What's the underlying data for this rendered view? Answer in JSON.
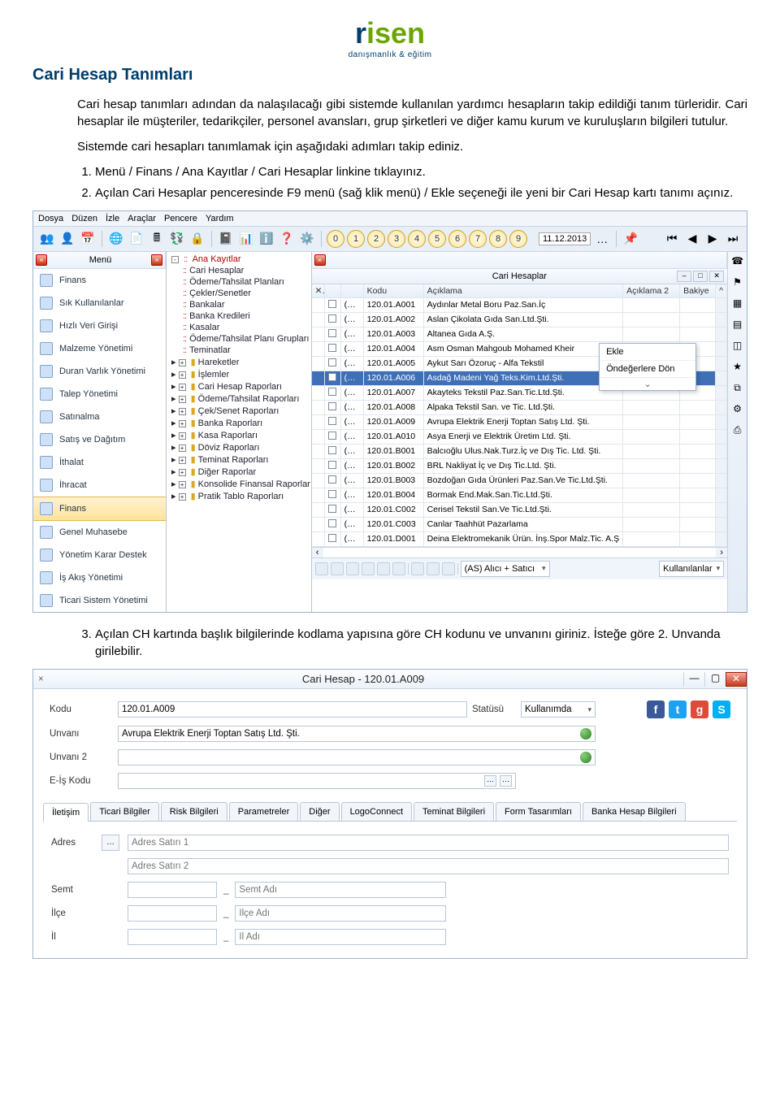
{
  "logo": {
    "brand_r": "r",
    "brand_isen": "isen",
    "sub": "danışmanlık & eğitim"
  },
  "doc_title": "Cari Hesap Tanımları",
  "para1": "Cari hesap tanımları adından da nalaşılacağı gibi sistemde kullanılan yardımcı hesapların takip edildiği tanım türleridir. Cari hesaplar ile müşteriler, tedarikçiler, personel avansları, grup şirketleri ve diğer kamu kurum ve kuruluşların bilgileri tutulur.",
  "para2": "Sistemde cari hesapları tanımlamak için aşağıdaki adımları takip ediniz.",
  "steps1": [
    "Menü / Finans / Ana Kayıtlar / Cari Hesaplar linkine tıklayınız.",
    "Açılan Cari Hesaplar penceresinde F9 menü (sağ klik menü) / Ekle seçeneği ile yeni bir Cari Hesap kartı tanımı açınız."
  ],
  "step3": "Açılan CH kartında başlık bilgilerinde kodlama yapısına göre CH kodunu ve unvanını giriniz. İsteğe göre 2. Unvanda girilebilir.",
  "app": {
    "menu": [
      "Dosya",
      "Düzen",
      "İzle",
      "Araçlar",
      "Pencere",
      "Yardım"
    ],
    "date": "11.12.2013",
    "nums": [
      "0",
      "1",
      "2",
      "3",
      "4",
      "5",
      "6",
      "7",
      "8",
      "9"
    ],
    "sidebar_title": "Menü",
    "side_items": [
      "Finans",
      "Sık Kullanılanlar",
      "Hızlı Veri Girişi",
      "Malzeme Yönetimi",
      "Duran Varlık Yönetimi",
      "Talep Yönetimi",
      "Satınalma",
      "Satış ve Dağıtım",
      "İthalat",
      "İhracat",
      "Finans",
      "Genel Muhasebe",
      "Yönetim Karar Destek",
      "İş Akış Yönetimi",
      "Ticari Sistem Yönetimi"
    ],
    "selected_side": 10,
    "tree": {
      "root": "Ana Kayıtlar",
      "root_items": [
        "Cari Hesaplar",
        "Ödeme/Tahsilat Planları",
        "Çekler/Senetler",
        "Bankalar",
        "Banka Kredileri",
        "Kasalar",
        "Ödeme/Tahsilat Planı Grupları",
        "Teminatlar"
      ],
      "folders": [
        "Hareketler",
        "İşlemler",
        "Cari Hesap Raporları",
        "Ödeme/Tahsilat Raporları",
        "Çek/Senet Raporları",
        "Banka Raporları",
        "Kasa Raporları",
        "Döviz Raporları",
        "Teminat Raporları",
        "Diğer Raporlar",
        "Konsolide Finansal Raporlar",
        "Pratik Tablo Raporları"
      ]
    },
    "grid": {
      "title": "Cari Hesaplar",
      "cols": {
        "chk": "",
        "as": "",
        "kod": "Kodu",
        "ack": "Açıklama",
        "ack2": "Açıklama 2",
        "bak": "Bakiye"
      },
      "rows": [
        {
          "kod": "120.01.A001",
          "ack": "Aydınlar Metal Boru Paz.San.İç"
        },
        {
          "kod": "120.01.A002",
          "ack": "Aslan Çikolata Gıda San.Ltd.Şti."
        },
        {
          "kod": "120.01.A003",
          "ack": "Altanea Gıda A.Ş."
        },
        {
          "kod": "120.01.A004",
          "ack": "Asm Osman Mahgoub Mohamed Kheir"
        },
        {
          "kod": "120.01.A005",
          "ack": "Aykut Sarı Özoruç - Alfa Tekstil"
        },
        {
          "kod": "120.01.A006",
          "ack": "Asdağ Madeni Yağ Teks.Kim.Ltd.Şti.",
          "sel": true
        },
        {
          "kod": "120.01.A007",
          "ack": "Akayteks Tekstil Paz.San.Tic.Ltd.Şti."
        },
        {
          "kod": "120.01.A008",
          "ack": "Alpaka Tekstil San. ve Tic. Ltd.Şti."
        },
        {
          "kod": "120.01.A009",
          "ack": "Avrupa Elektrik Enerji Toptan Satış Ltd. Şti."
        },
        {
          "kod": "120.01.A010",
          "ack": "Asya Enerji ve Elektrik Üretim Ltd. Şti."
        },
        {
          "kod": "120.01.B001",
          "ack": "Balcıoğlu Ulus.Nak.Turz.İç ve Dış Tic. Ltd. Şti."
        },
        {
          "kod": "120.01.B002",
          "ack": "BRL Nakliyat İç ve Dış Tic.Ltd. Şti."
        },
        {
          "kod": "120.01.B003",
          "ack": "Bozdoğan Gıda Ürünleri Paz.San.Ve Tic.Ltd.Şti."
        },
        {
          "kod": "120.01.B004",
          "ack": "Bormak End.Mak.San.Tic.Ltd.Şti."
        },
        {
          "kod": "120.01.C002",
          "ack": "Cerisel Tekstil San.Ve Tic.Ltd.Şti."
        },
        {
          "kod": "120.01.C003",
          "ack": "Canlar Taahhüt Pazarlama"
        },
        {
          "kod": "120.01.D001",
          "ack": "Deina Elektromekanik Ürün. İnş.Spor Malz.Tic. A.Ş"
        }
      ],
      "as_prefix": "(AS)",
      "footer_select": "(AS) Alıcı + Satıcı",
      "footer_right": "Kullanılanlar"
    },
    "context_menu": [
      "Ekle",
      "Öndeğerlere Dön"
    ]
  },
  "card": {
    "title": "Cari Hesap - 120.01.A009",
    "labels": {
      "kodu": "Kodu",
      "unvani": "Unvanı",
      "unvani2": "Unvanı 2",
      "eis": "E-İş Kodu",
      "statu": "Statüsü"
    },
    "values": {
      "kodu": "120.01.A009",
      "unvani": "Avrupa Elektrik Enerji Toptan Satış Ltd. Şti.",
      "statu": "Kullanımda"
    },
    "tabs": [
      "İletişim",
      "Ticari Bilgiler",
      "Risk Bilgileri",
      "Parametreler",
      "Diğer",
      "LogoConnect",
      "Teminat Bilgileri",
      "Form Tasarımları",
      "Banka Hesap Bilgileri"
    ],
    "iletisim": {
      "adres": "Adres",
      "adres_ph1": "Adres Satırı 1",
      "adres_ph2": "Adres Satırı 2",
      "semt": "Semt",
      "semt_ph": "Semt Adı",
      "ilce": "İlçe",
      "ilce_ph": "İlçe Adı",
      "il": "İl",
      "il_ph": "İl Adı",
      "dash": "_"
    }
  }
}
